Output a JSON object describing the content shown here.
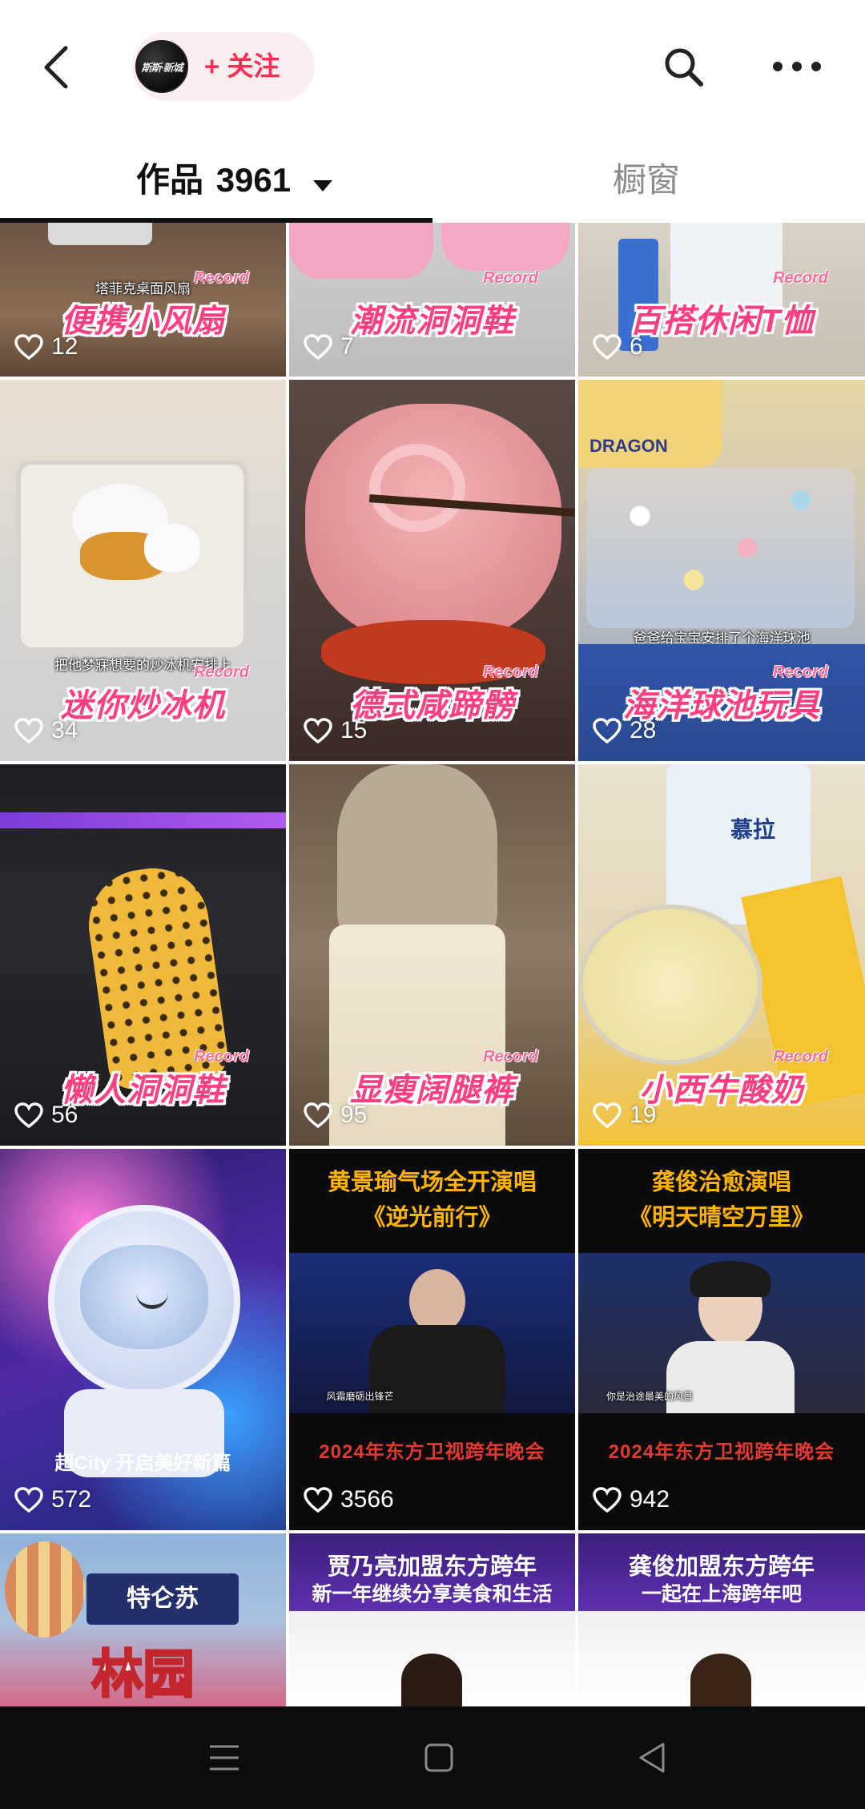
{
  "header": {
    "avatar_logo": "斯斯·新城",
    "follow_label": "+ 关注"
  },
  "tabs": {
    "works_label": "作品",
    "works_count": "3961",
    "window_label": "橱窗"
  },
  "tiles": [
    {
      "caption": "便携小风扇",
      "likes": "12",
      "small": "塔菲克桌面风扇"
    },
    {
      "caption": "潮流洞洞鞋",
      "likes": "7"
    },
    {
      "caption": "百搭休闲T恤",
      "likes": "6"
    },
    {
      "caption": "迷你炒冰机",
      "likes": "34",
      "small": "把他梦寐想要的炒冰机安排上"
    },
    {
      "caption": "德式咸蹄髈",
      "likes": "15"
    },
    {
      "caption": "海洋球池玩具",
      "likes": "28",
      "small": "爸爸给宝宝安排了个海洋球池",
      "tag": "DRAGON"
    },
    {
      "caption": "懒人洞洞鞋",
      "likes": "56"
    },
    {
      "caption": "显瘦阔腿裤",
      "likes": "95"
    },
    {
      "caption": "小西牛酸奶",
      "likes": "19",
      "tag": "慕拉"
    },
    {
      "overlay": "超City  开启美好新篇",
      "likes": "572"
    },
    {
      "top1": "黄景瑜气场全开演唱",
      "top2": "《逆光前行》",
      "bottom": "2024年东方卫视跨年晚会",
      "likes": "3566",
      "small": "风霜磨砺出锋芒"
    },
    {
      "top1": "龚俊治愈演唱",
      "top2": "《明天晴空万里》",
      "bottom": "2024年东方卫视跨年晚会",
      "likes": "942",
      "small": "你是治途最美的风景"
    },
    {
      "brand": "特仑苏",
      "big": "林园"
    },
    {
      "top1": "贾乃亮加盟东方跨年",
      "top2": "新一年继续分享美食和生活"
    },
    {
      "top1": "龚俊加盟东方跨年",
      "top2": "一起在上海跨年吧"
    }
  ],
  "record_label": "Record",
  "colors": {
    "accent": "#fe2c55",
    "caption_pink": "#ff3d7f",
    "navbar_bg": "#0c0c0c"
  },
  "icons": {
    "back": "chevron-left-icon",
    "search": "search-icon",
    "more": "more-dots-icon",
    "like": "heart-outline-icon",
    "nav_menu": "menu-icon",
    "nav_home": "square-home-icon",
    "nav_back": "triangle-back-icon"
  }
}
